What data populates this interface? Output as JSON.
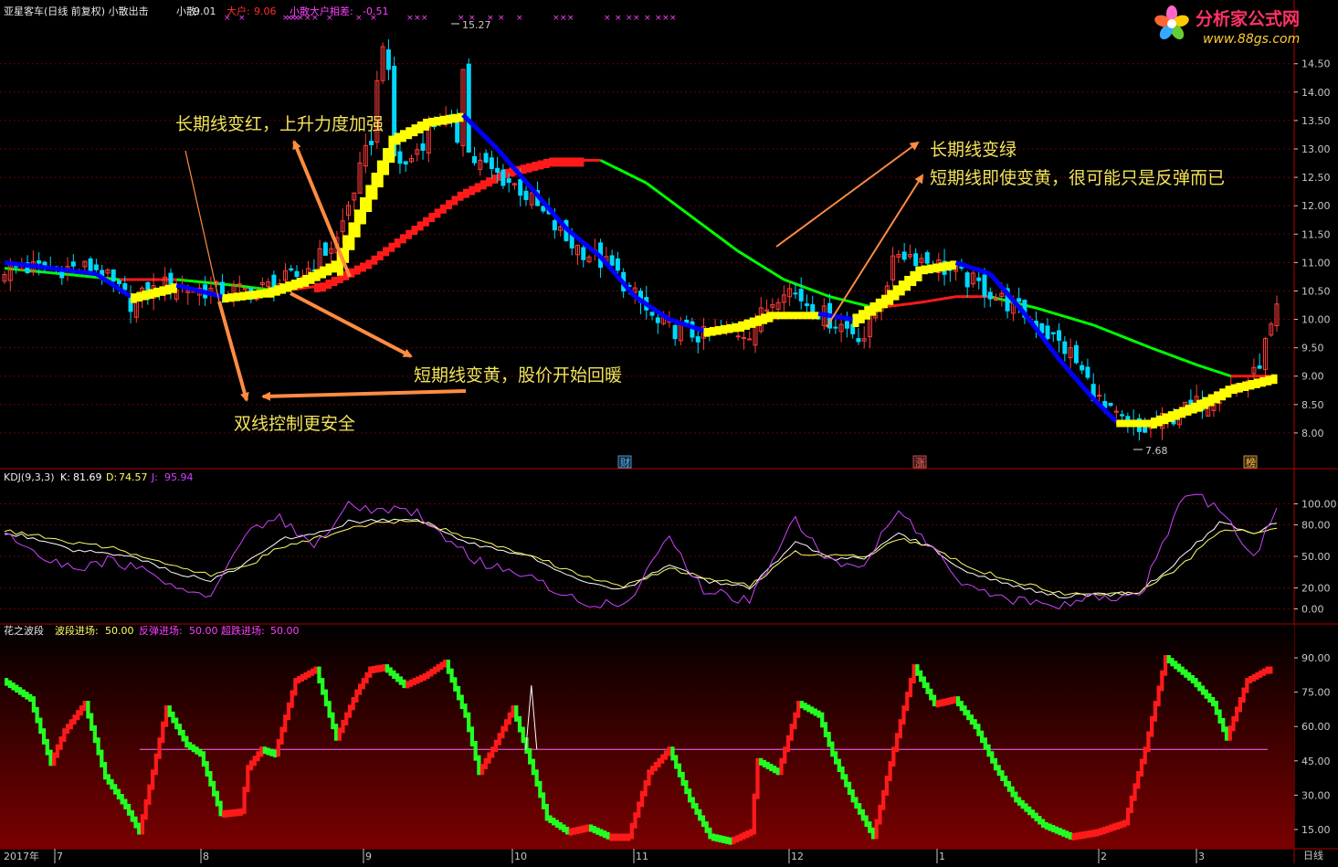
{
  "colors": {
    "up": "#ff3c3c",
    "down": "#00d8ff",
    "yellow": "#ffff00",
    "red": "#ff1a1a",
    "blue": "#0000ff",
    "green": "#00ff00",
    "grid": "#6a0000",
    "axis": "#c8c8c8",
    "magenta": "#ff40ff",
    "annot": "#f2e35a",
    "arrow": "#ff8c42",
    "kdjD": "#ffff66",
    "kdjJ": "#cc44ff"
  },
  "header": {
    "title": "亚星客车(日线 前复权) 小散出击",
    "small_label": "小散:",
    "small_value": "9.01",
    "big_label": "大户:",
    "big_value": "9.06",
    "diff_label": "小散大户相差:",
    "diff_value": "-0.51"
  },
  "logo": {
    "name": "分析家公式网",
    "url": "www.88gs.com"
  },
  "price_axis": [
    "14.50",
    "14.00",
    "13.50",
    "13.00",
    "12.50",
    "12.00",
    "11.50",
    "11.00",
    "10.50",
    "10.00",
    "9.50",
    "9.00",
    "8.50",
    "8.00"
  ],
  "price_markers": {
    "high": "15.27",
    "low": "7.68"
  },
  "event_tags": [
    "财",
    "涨",
    "榜"
  ],
  "annotations": {
    "a1": "长期线变红，上升力度加强",
    "a2": "长期线变绿",
    "a3": "短期线即使变黄，很可能只是反弹而已",
    "a4": "短期线变黄，股价开始回暖",
    "a5": "双线控制更安全"
  },
  "kdj": {
    "title": "KDJ(9,3,3)",
    "k_label": "K:",
    "k_value": "81.69",
    "d_label": "D:",
    "d_value": "74.57",
    "j_label": "J:",
    "j_value": "95.94",
    "axis": [
      "100.00",
      "80.00",
      "50.00",
      "20.00",
      "0.00"
    ]
  },
  "wave": {
    "title": "花之波段",
    "bd_label": "波段进场:",
    "bd_value": "50.00",
    "ft_label": "反弹进场:",
    "ft_value": "50.00",
    "cd_label": "超跌进场:",
    "cd_value": "50.00",
    "axis": [
      "90.00",
      "75.00",
      "60.00",
      "45.00",
      "30.00",
      "15.00"
    ]
  },
  "x_axis": {
    "year": "2017年",
    "months": [
      "7",
      "8",
      "9",
      "10",
      "11",
      "12",
      "1",
      "2",
      "3"
    ],
    "period": "日线"
  },
  "chart_data": [
    {
      "type": "candlestick",
      "title": "亚星客车(日线 前复权) 小散出击",
      "ylim": [
        7.5,
        15.3
      ],
      "y_ticks": [
        8.0,
        8.5,
        9.0,
        9.5,
        10.0,
        10.5,
        11.0,
        11.5,
        12.0,
        12.5,
        13.0,
        13.5,
        14.0,
        14.5
      ],
      "x_months": [
        "7",
        "8",
        "9",
        "10",
        "11",
        "12",
        "1",
        "2",
        "3"
      ],
      "close_anchors": [
        [
          0,
          10.9
        ],
        [
          8,
          10.9
        ],
        [
          16,
          10.9
        ],
        [
          22,
          10.3
        ],
        [
          28,
          10.6
        ],
        [
          36,
          10.5
        ],
        [
          44,
          10.5
        ],
        [
          52,
          10.8
        ],
        [
          58,
          11.4
        ],
        [
          64,
          13.2
        ],
        [
          70,
          12.7
        ],
        [
          76,
          13.6
        ],
        [
          82,
          12.8
        ],
        [
          90,
          12.3
        ],
        [
          98,
          11.4
        ],
        [
          106,
          10.9
        ],
        [
          114,
          9.9
        ],
        [
          122,
          9.7
        ],
        [
          130,
          9.8
        ],
        [
          136,
          10.6
        ],
        [
          144,
          10.0
        ],
        [
          150,
          9.7
        ],
        [
          156,
          11.2
        ],
        [
          162,
          11.0
        ],
        [
          170,
          10.6
        ],
        [
          178,
          10.1
        ],
        [
          186,
          9.4
        ],
        [
          192,
          8.4
        ],
        [
          198,
          8.0
        ],
        [
          204,
          8.3
        ],
        [
          212,
          8.7
        ],
        [
          218,
          9.0
        ],
        [
          222,
          10.1
        ]
      ],
      "short_line_anchors": [
        [
          0,
          11.0
        ],
        [
          8,
          10.9
        ],
        [
          16,
          10.8
        ],
        [
          22,
          10.4
        ],
        [
          30,
          10.6
        ],
        [
          38,
          10.4
        ],
        [
          46,
          10.5
        ],
        [
          52,
          10.7
        ],
        [
          58,
          11.0
        ],
        [
          62,
          11.9
        ],
        [
          68,
          13.2
        ],
        [
          74,
          13.5
        ],
        [
          80,
          13.6
        ],
        [
          86,
          13.0
        ],
        [
          92,
          12.3
        ],
        [
          98,
          11.6
        ],
        [
          104,
          11.1
        ],
        [
          110,
          10.4
        ],
        [
          116,
          10.0
        ],
        [
          122,
          9.8
        ],
        [
          128,
          9.9
        ],
        [
          134,
          10.1
        ],
        [
          142,
          10.1
        ],
        [
          148,
          10.0
        ],
        [
          154,
          10.4
        ],
        [
          160,
          10.9
        ],
        [
          166,
          11.0
        ],
        [
          172,
          10.8
        ],
        [
          178,
          10.1
        ],
        [
          184,
          9.3
        ],
        [
          190,
          8.6
        ],
        [
          194,
          8.2
        ],
        [
          200,
          8.2
        ],
        [
          208,
          8.5
        ],
        [
          214,
          8.8
        ],
        [
          222,
          9.0
        ]
      ],
      "long_line_anchors": [
        [
          0,
          10.9
        ],
        [
          10,
          10.8
        ],
        [
          20,
          10.7
        ],
        [
          30,
          10.7
        ],
        [
          40,
          10.6
        ],
        [
          48,
          10.5
        ],
        [
          56,
          10.6
        ],
        [
          64,
          11.0
        ],
        [
          72,
          11.6
        ],
        [
          80,
          12.2
        ],
        [
          88,
          12.6
        ],
        [
          96,
          12.8
        ],
        [
          104,
          12.8
        ],
        [
          112,
          12.4
        ],
        [
          120,
          11.8
        ],
        [
          128,
          11.2
        ],
        [
          136,
          10.7
        ],
        [
          144,
          10.4
        ],
        [
          152,
          10.2
        ],
        [
          160,
          10.3
        ],
        [
          166,
          10.4
        ],
        [
          172,
          10.4
        ],
        [
          180,
          10.2
        ],
        [
          190,
          9.9
        ],
        [
          200,
          9.5
        ],
        [
          208,
          9.2
        ],
        [
          214,
          9.0
        ],
        [
          222,
          9.0
        ]
      ],
      "series": [
        {
          "name": "小散",
          "value": 9.01
        },
        {
          "name": "大户",
          "value": 9.06
        }
      ]
    },
    {
      "type": "line",
      "title": "KDJ(9,3,3)",
      "ylim": [
        -10,
        110
      ],
      "y_ticks": [
        0,
        20,
        50,
        80,
        100
      ],
      "series": [
        {
          "name": "K",
          "value": 81.69,
          "anchors": [
            [
              0,
              73
            ],
            [
              6,
              66
            ],
            [
              12,
              55
            ],
            [
              18,
              54
            ],
            [
              24,
              47
            ],
            [
              30,
              34
            ],
            [
              36,
              28
            ],
            [
              42,
              42
            ],
            [
              48,
              66
            ],
            [
              54,
              70
            ],
            [
              60,
              83
            ],
            [
              66,
              85
            ],
            [
              72,
              86
            ],
            [
              78,
              70
            ],
            [
              84,
              58
            ],
            [
              92,
              49
            ],
            [
              100,
              28
            ],
            [
              108,
              18
            ],
            [
              116,
              42
            ],
            [
              122,
              27
            ],
            [
              130,
              20
            ],
            [
              138,
              64
            ],
            [
              144,
              48
            ],
            [
              150,
              48
            ],
            [
              156,
              71
            ],
            [
              162,
              58
            ],
            [
              168,
              34
            ],
            [
              176,
              22
            ],
            [
              184,
              12
            ],
            [
              190,
              13
            ],
            [
              198,
              16
            ],
            [
              206,
              52
            ],
            [
              212,
              82
            ],
            [
              218,
              73
            ],
            [
              222,
              82
            ]
          ]
        },
        {
          "name": "D",
          "value": 74.57,
          "anchors": [
            [
              0,
              74
            ],
            [
              6,
              70
            ],
            [
              12,
              62
            ],
            [
              18,
              59
            ],
            [
              24,
              50
            ],
            [
              30,
              40
            ],
            [
              36,
              32
            ],
            [
              42,
              40
            ],
            [
              48,
              58
            ],
            [
              54,
              66
            ],
            [
              60,
              77
            ],
            [
              66,
              82
            ],
            [
              72,
              84
            ],
            [
              78,
              73
            ],
            [
              84,
              62
            ],
            [
              92,
              52
            ],
            [
              100,
              32
            ],
            [
              108,
              22
            ],
            [
              116,
              38
            ],
            [
              122,
              30
            ],
            [
              130,
              22
            ],
            [
              138,
              54
            ],
            [
              144,
              50
            ],
            [
              150,
              50
            ],
            [
              156,
              66
            ],
            [
              162,
              60
            ],
            [
              168,
              40
            ],
            [
              176,
              27
            ],
            [
              184,
              15
            ],
            [
              190,
              13
            ],
            [
              198,
              15
            ],
            [
              206,
              44
            ],
            [
              212,
              75
            ],
            [
              218,
              73
            ],
            [
              222,
              76
            ]
          ]
        },
        {
          "name": "J",
          "value": 95.94,
          "anchors": [
            [
              0,
              72
            ],
            [
              6,
              52
            ],
            [
              12,
              38
            ],
            [
              18,
              46
            ],
            [
              24,
              38
            ],
            [
              30,
              18
            ],
            [
              36,
              8
            ],
            [
              42,
              70
            ],
            [
              48,
              86
            ],
            [
              54,
              62
            ],
            [
              60,
              98
            ],
            [
              66,
              94
            ],
            [
              72,
              92
            ],
            [
              78,
              60
            ],
            [
              84,
              42
            ],
            [
              92,
              30
            ],
            [
              100,
              8
            ],
            [
              108,
              2
            ],
            [
              116,
              68
            ],
            [
              122,
              18
            ],
            [
              130,
              8
            ],
            [
              138,
              86
            ],
            [
              144,
              44
            ],
            [
              150,
              42
            ],
            [
              156,
              98
            ],
            [
              162,
              56
            ],
            [
              168,
              22
            ],
            [
              176,
              8
            ],
            [
              184,
              4
            ],
            [
              190,
              10
            ],
            [
              198,
              10
            ],
            [
              206,
              112
            ],
            [
              212,
              96
            ],
            [
              218,
              48
            ],
            [
              222,
              96
            ]
          ]
        }
      ]
    },
    {
      "type": "bar",
      "title": "花之波段",
      "ylim": [
        7,
        98
      ],
      "y_ticks": [
        15,
        30,
        45,
        60,
        75,
        90
      ],
      "threshold": 50,
      "series": [
        {
          "name": "波段进场",
          "value": 50.0
        },
        {
          "name": "反弹进场",
          "value": 50.0
        },
        {
          "name": "超跌进场",
          "value": 50.0
        }
      ],
      "wave_anchors": [
        [
          0,
          80
        ],
        [
          8,
          72
        ],
        [
          14,
          44
        ],
        [
          18,
          58
        ],
        [
          24,
          70
        ],
        [
          30,
          38
        ],
        [
          36,
          25
        ],
        [
          40,
          14
        ],
        [
          44,
          40
        ],
        [
          48,
          68
        ],
        [
          54,
          52
        ],
        [
          58,
          48
        ],
        [
          64,
          22
        ],
        [
          70,
          23
        ],
        [
          72,
          42
        ],
        [
          76,
          50
        ],
        [
          80,
          48
        ],
        [
          86,
          80
        ],
        [
          92,
          85
        ],
        [
          98,
          55
        ],
        [
          104,
          75
        ],
        [
          108,
          85
        ],
        [
          112,
          86
        ],
        [
          118,
          78
        ],
        [
          124,
          82
        ],
        [
          130,
          88
        ],
        [
          136,
          65
        ],
        [
          140,
          40
        ],
        [
          144,
          50
        ],
        [
          150,
          68
        ],
        [
          156,
          40
        ],
        [
          160,
          20
        ],
        [
          166,
          14
        ],
        [
          172,
          16
        ],
        [
          178,
          12
        ],
        [
          184,
          12
        ],
        [
          190,
          40
        ],
        [
          196,
          50
        ],
        [
          202,
          28
        ],
        [
          208,
          12
        ],
        [
          214,
          10
        ],
        [
          220,
          14
        ],
        [
          222,
          45
        ],
        [
          228,
          40
        ],
        [
          234,
          70
        ],
        [
          240,
          65
        ],
        [
          244,
          48
        ],
        [
          250,
          28
        ],
        [
          256,
          12
        ],
        [
          262,
          50
        ],
        [
          268,
          86
        ],
        [
          274,
          70
        ],
        [
          280,
          72
        ],
        [
          286,
          60
        ],
        [
          292,
          42
        ],
        [
          298,
          28
        ],
        [
          306,
          17
        ],
        [
          314,
          12
        ],
        [
          322,
          14
        ],
        [
          330,
          18
        ],
        [
          336,
          50
        ],
        [
          342,
          90
        ],
        [
          350,
          80
        ],
        [
          356,
          70
        ],
        [
          360,
          55
        ],
        [
          366,
          80
        ],
        [
          372,
          85
        ]
      ],
      "spike": {
        "index": 155,
        "value": 78
      }
    }
  ]
}
